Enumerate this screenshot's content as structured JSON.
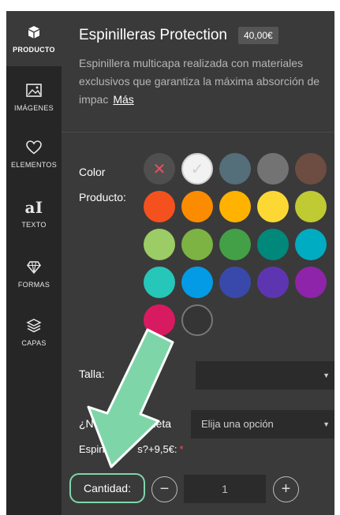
{
  "sidebar": {
    "items": [
      {
        "label": "PRODUCTO",
        "icon": "cube-icon",
        "active": true
      },
      {
        "label": "IMÁGENES",
        "icon": "image-icon"
      },
      {
        "label": "ELEMENTOS",
        "icon": "heart-icon"
      },
      {
        "label": "TEXTO",
        "icon": "text-icon",
        "glyph": "aI"
      },
      {
        "label": "FORMAS",
        "icon": "diamond-icon"
      },
      {
        "label": "CAPAS",
        "icon": "layers-icon"
      }
    ]
  },
  "product": {
    "title": "Espinilleras Protection",
    "price": "40,00€",
    "description": "Espinillera multicapa realizada con materiales exclusivos que garantiza la máxima absorción de impac",
    "more_link": "Más"
  },
  "color": {
    "label_line1": "Color",
    "label_line2": "Producto:",
    "swatches": [
      {
        "name": "none",
        "hex": "#4f4f4f",
        "glyph": "✕",
        "glyph_color": "#e8505b"
      },
      {
        "name": "white",
        "hex": "#f2f2f2",
        "glyph": "✓",
        "glyph_color": "#d0d0d0"
      },
      {
        "name": "slate",
        "hex": "#546e7a"
      },
      {
        "name": "gray",
        "hex": "#737373"
      },
      {
        "name": "brown",
        "hex": "#6d4c41"
      },
      {
        "name": "red-orange",
        "hex": "#f4511e"
      },
      {
        "name": "orange",
        "hex": "#fb8c00"
      },
      {
        "name": "amber",
        "hex": "#ffb300"
      },
      {
        "name": "yellow",
        "hex": "#fdd835"
      },
      {
        "name": "lime",
        "hex": "#c0ca33"
      },
      {
        "name": "light-green",
        "hex": "#9ccc65"
      },
      {
        "name": "green",
        "hex": "#7cb342"
      },
      {
        "name": "medium-green",
        "hex": "#43a047"
      },
      {
        "name": "teal",
        "hex": "#00897b"
      },
      {
        "name": "cyan",
        "hex": "#00acc1"
      },
      {
        "name": "turquoise",
        "hex": "#26c6b8"
      },
      {
        "name": "sky-blue",
        "hex": "#039be5"
      },
      {
        "name": "indigo",
        "hex": "#3949ab"
      },
      {
        "name": "deep-purple",
        "hex": "#5e35b1"
      },
      {
        "name": "purple",
        "hex": "#8e24aa"
      },
      {
        "name": "pink",
        "hex": "#d81b60"
      },
      {
        "name": "black",
        "hex": "#353535"
      }
    ]
  },
  "talla": {
    "label": "Talla:"
  },
  "necesita": {
    "label": "¿Ne",
    "label_end": "ieta",
    "select_value": "Elija una opción"
  },
  "espinilleras": {
    "label": "Espinil",
    "label_end": "s?+9,5€:",
    "required": "*"
  },
  "cantidad": {
    "label": "Cantidad:",
    "value": "1",
    "minus": "−",
    "plus": "+"
  },
  "accent": {
    "annotation_green": "#7ed6a8"
  }
}
